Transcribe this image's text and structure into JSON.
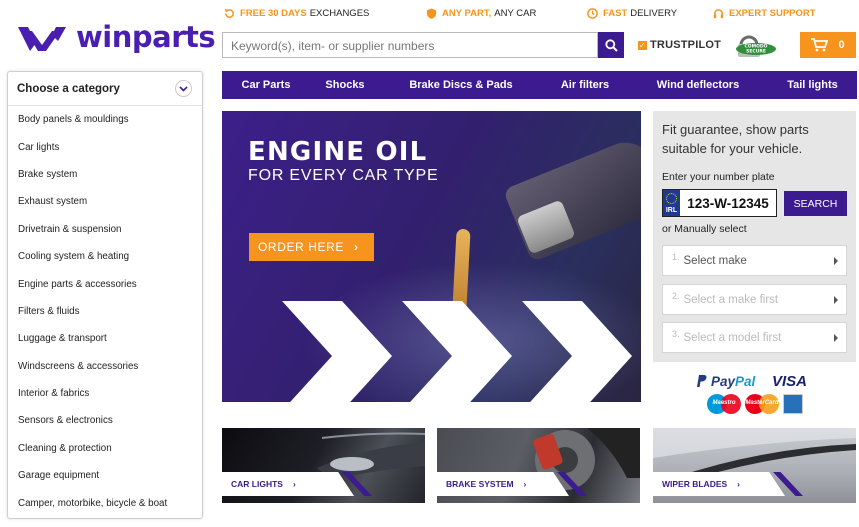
{
  "brand": {
    "name": "winparts",
    "primary": "#3b1b8f",
    "accent": "#f7941d"
  },
  "usps": [
    {
      "highlight": "FREE 30 DAYS",
      "rest": "EXCHANGES",
      "icon": "exchange-icon"
    },
    {
      "highlight": "ANY PART,",
      "rest": "ANY CAR",
      "icon": "shield-icon"
    },
    {
      "highlight": "FAST",
      "rest": "DELIVERY",
      "icon": "delivery-icon"
    },
    {
      "highlight": "EXPERT SUPPORT",
      "rest": "",
      "icon": "headset-icon"
    }
  ],
  "search": {
    "placeholder": "Keyword(s), item- or supplier numbers"
  },
  "trust": {
    "trustpilot": "TRUSTPILOT",
    "secure_line1": "COMODO",
    "secure_line2": "SECURE"
  },
  "cart": {
    "count": "0"
  },
  "sidebar": {
    "title": "Choose a category",
    "items": [
      "Body panels & mouldings",
      "Car lights",
      "Brake system",
      "Exhaust system",
      "Drivetrain & suspension",
      "Cooling system & heating",
      "Engine parts & accessories",
      "Filters & fluids",
      "Luggage & transport",
      "Windscreens & accessories",
      "Interior & fabrics",
      "Sensors & electronics",
      "Cleaning & protection",
      "Garage equipment",
      "Camper, motorbike, bicycle & boat"
    ]
  },
  "nav": [
    "Car Parts",
    "Shocks",
    "Brake Discs & Pads",
    "Air filters",
    "Wind deflectors",
    "Tail lights"
  ],
  "banner": {
    "title": "ENGINE OIL",
    "subtitle": "FOR EVERY CAR TYPE",
    "cta": "ORDER HERE"
  },
  "finder": {
    "title": "Fit guarantee, show parts suitable for your vehicle.",
    "plate_label": "Enter your number plate",
    "country_code": "IRL",
    "plate_value": "123-W-12345",
    "search_label": "SEARCH",
    "manual_label": "or Manually select",
    "selects": [
      {
        "num": "1.",
        "text": "Select make"
      },
      {
        "num": "2.",
        "text": "Select a make first"
      },
      {
        "num": "3.",
        "text": "Select a model first"
      }
    ]
  },
  "payments": {
    "paypal_a": "Pay",
    "paypal_b": "Pal",
    "visa": "VISA",
    "maestro": "Maestro",
    "mastercard": "MasterCard"
  },
  "tiles": [
    {
      "label": "CAR LIGHTS"
    },
    {
      "label": "BRAKE SYSTEM"
    },
    {
      "label": "WIPER BLADES"
    }
  ]
}
